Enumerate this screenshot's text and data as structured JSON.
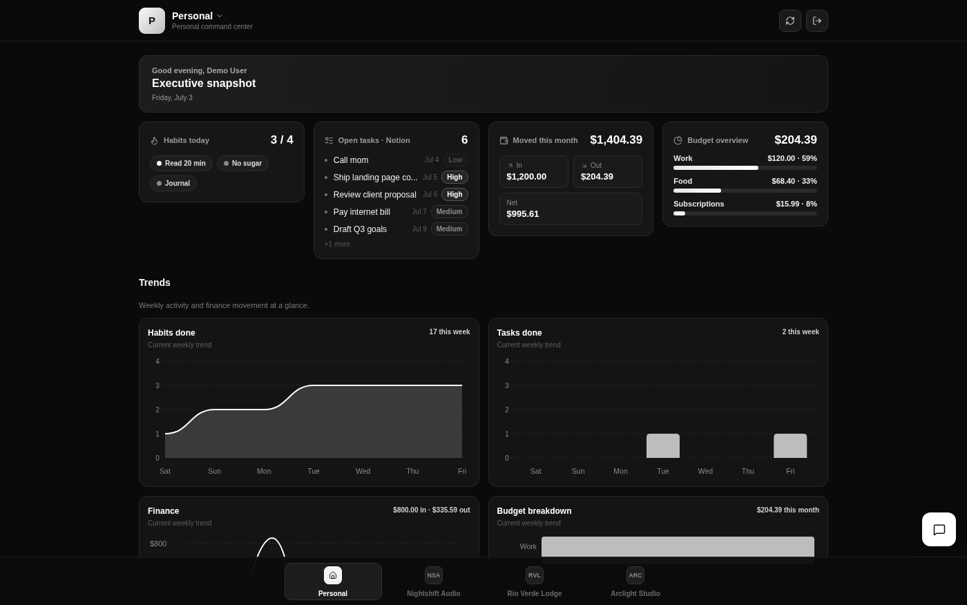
{
  "header": {
    "initial": "P",
    "title": "Personal",
    "subtitle": "Personal command center"
  },
  "hero": {
    "greeting": "Good evening, Demo User",
    "title": "Executive snapshot",
    "date": "Friday, July 3"
  },
  "habits": {
    "title": "Habits today",
    "count": "3 / 4",
    "items": [
      {
        "label": "Read 20 min",
        "done": true
      },
      {
        "label": "No sugar",
        "done": false
      },
      {
        "label": "Journal",
        "done": false
      }
    ]
  },
  "tasks": {
    "title": "Open tasks · Notion",
    "count": "6",
    "more": "+1 more",
    "items": [
      {
        "name": "Call mom",
        "date": "Jul 4",
        "priority": "Low",
        "kind": "low"
      },
      {
        "name": "Ship landing page co...",
        "date": "Jul 5",
        "priority": "High",
        "kind": "high"
      },
      {
        "name": "Review client proposal",
        "date": "Jul 6",
        "priority": "High",
        "kind": "high"
      },
      {
        "name": "Pay internet bill",
        "date": "Jul 7",
        "priority": "Medium",
        "kind": "medium"
      },
      {
        "name": "Draft Q3 goals",
        "date": "Jul 9",
        "priority": "Medium",
        "kind": "medium"
      }
    ]
  },
  "moved": {
    "title": "Moved this month",
    "total": "$1,404.39",
    "in_label": "In",
    "in_value": "$1,200.00",
    "out_label": "Out",
    "out_value": "$204.39",
    "net_label": "Net",
    "net_value": "$995.61"
  },
  "budget": {
    "title": "Budget overview",
    "total": "$204.39",
    "items": [
      {
        "name": "Work",
        "amount": "$120.00 · 59%",
        "level": 0.59
      },
      {
        "name": "Food",
        "amount": "$68.40 · 33%",
        "level": 0.33
      },
      {
        "name": "Subscriptions",
        "amount": "$15.99 · 8%",
        "level": 0.08
      }
    ]
  },
  "trends": {
    "title": "Trends",
    "subtitle": "Weekly activity and finance movement at a glance."
  },
  "charts": [
    {
      "title": "Habits done",
      "summary": "17 this week",
      "subtitle": "Current weekly trend",
      "chart_data": {
        "type": "area",
        "categories": [
          "Sat",
          "Sun",
          "Mon",
          "Tue",
          "Wed",
          "Thu",
          "Fri"
        ],
        "ylim": [
          0,
          4
        ],
        "yticks": [
          0,
          1,
          2,
          3,
          4
        ],
        "grid": true,
        "values": [
          1,
          2,
          2,
          3,
          3,
          3,
          3
        ]
      }
    },
    {
      "title": "Tasks done",
      "summary": "2 this week",
      "subtitle": "Current weekly trend",
      "chart_data": {
        "type": "bar",
        "categories": [
          "Sat",
          "Sun",
          "Mon",
          "Tue",
          "Wed",
          "Thu",
          "Fri"
        ],
        "ylim": [
          0,
          4
        ],
        "yticks": [
          0,
          1,
          2,
          3,
          4
        ],
        "grid": true,
        "values": [
          0,
          0,
          0,
          1,
          0,
          0,
          1
        ]
      }
    }
  ],
  "finance": {
    "title": "Finance",
    "summary": "$800.00 in · $335.59 out",
    "subtitle": "Current weekly trend",
    "tick": "$800"
  },
  "breakdown": {
    "title": "Budget breakdown",
    "summary": "$204.39 this month",
    "subtitle": "Current weekly trend",
    "category": "Work"
  },
  "nav": [
    {
      "label": "Personal",
      "kind": "home",
      "selected": true
    },
    {
      "label": "Nightshift Audio",
      "kind": "initials",
      "initials": "NSA",
      "selected": false
    },
    {
      "label": "Rio Verde Lodge",
      "kind": "initials",
      "initials": "RVL",
      "selected": false
    },
    {
      "label": "Arclight Studio",
      "kind": "initials",
      "initials": "ARC",
      "selected": false
    }
  ]
}
